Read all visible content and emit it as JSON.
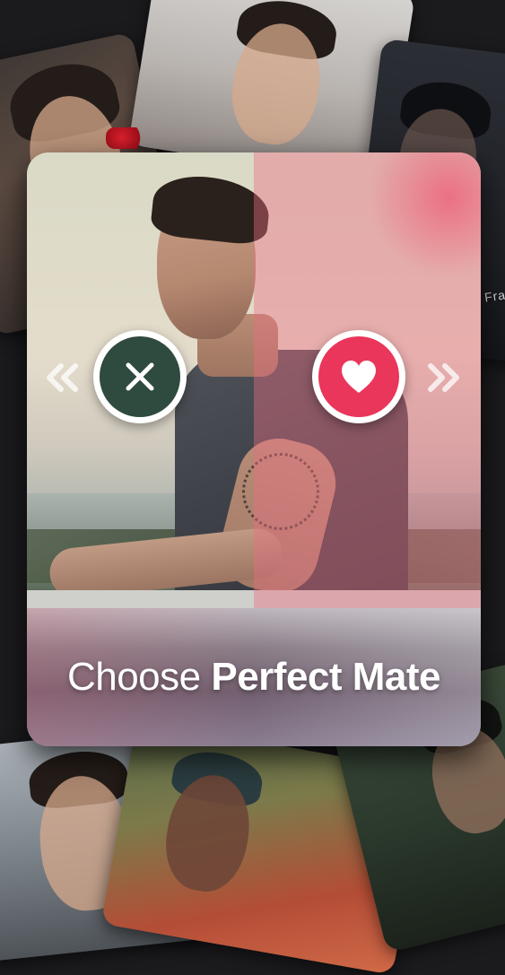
{
  "tagline": {
    "light": "Choose",
    "bold": "Perfect Mate"
  },
  "background": {
    "fragment_text": "Fra"
  },
  "actions": {
    "reject_icon": "close-icon",
    "like_icon": "heart-icon",
    "left_hint_icon": "double-chevron-left-icon",
    "right_hint_icon": "double-chevron-right-icon"
  },
  "colors": {
    "reject_button": "#2f4a3f",
    "like_button": "#e9365a",
    "overlay_pink": "#ec6e82"
  }
}
